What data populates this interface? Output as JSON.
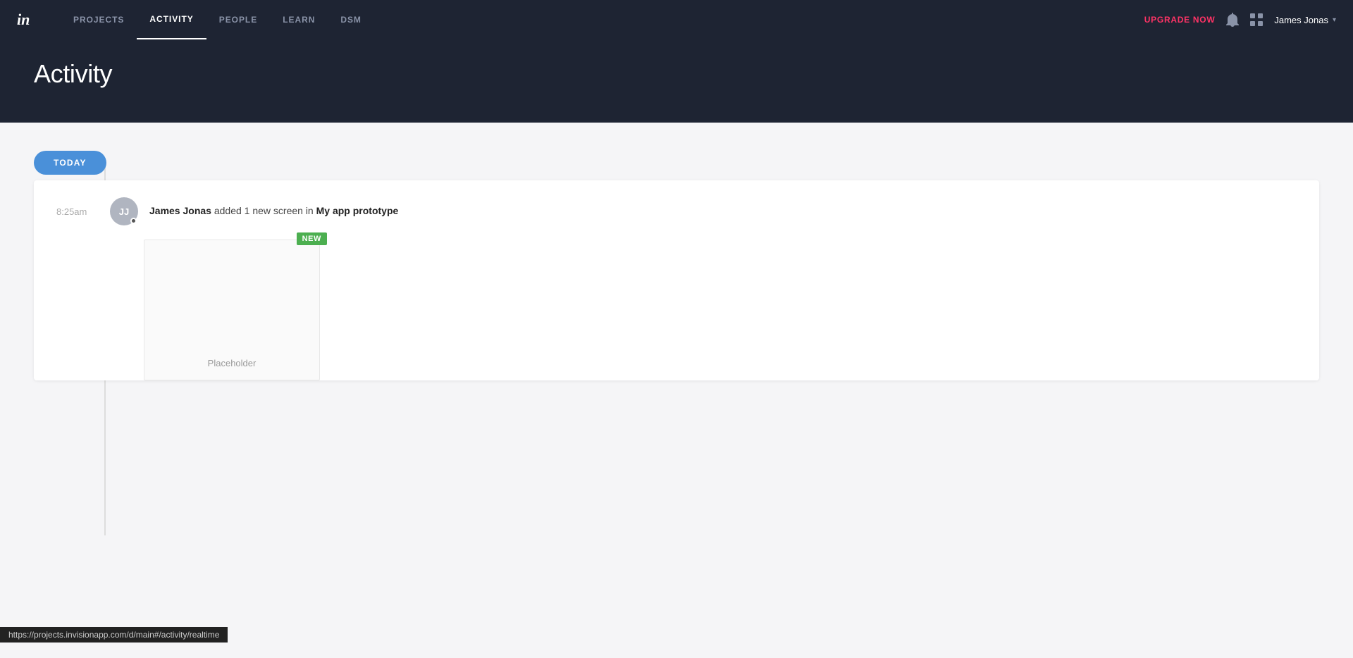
{
  "nav": {
    "logo_symbol": "in",
    "links": [
      {
        "id": "projects",
        "label": "PROJECTS",
        "active": false
      },
      {
        "id": "activity",
        "label": "ACTIVITY",
        "active": true
      },
      {
        "id": "people",
        "label": "PEOPLE",
        "active": false
      },
      {
        "id": "learn",
        "label": "LEARN",
        "active": false
      },
      {
        "id": "dsm",
        "label": "DSM",
        "active": false
      }
    ],
    "upgrade_label": "UPGRADE NOW",
    "user_name": "James Jonas"
  },
  "page": {
    "title": "Activity"
  },
  "timeline": {
    "today_label": "TODAY"
  },
  "activity": {
    "time": "8:25am",
    "avatar_initials": "JJ",
    "user_name": "James Jonas",
    "action_text": " added 1 new screen in ",
    "project_name": "My app prototype",
    "badge_label": "NEW",
    "screen_label": "Placeholder"
  },
  "status_bar": {
    "url": "https://projects.invisionapp.com/d/main#/activity/realtime"
  }
}
